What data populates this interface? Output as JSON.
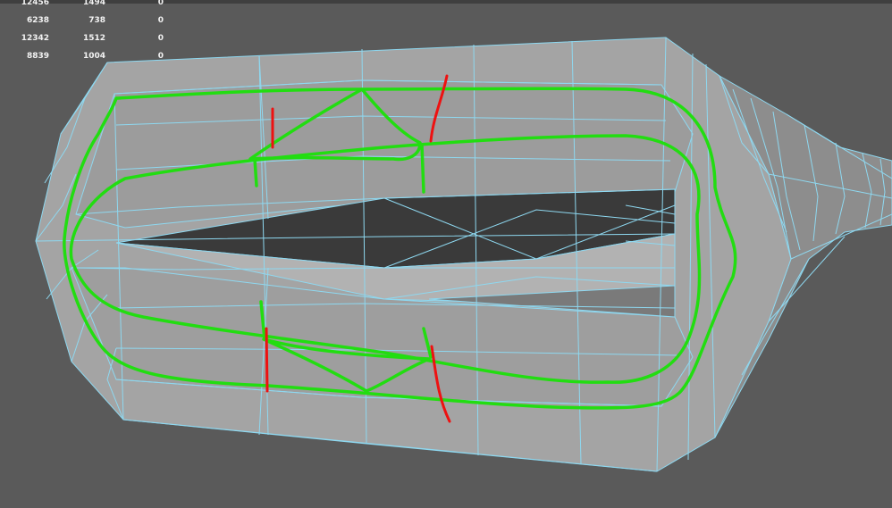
{
  "hud": {
    "rows": [
      [
        "12456",
        "1494",
        "0"
      ],
      [
        "6238",
        "738",
        "0"
      ],
      [
        "12342",
        "1512",
        "0"
      ],
      [
        "8839",
        "1004",
        "0"
      ]
    ]
  },
  "colors": {
    "background": "#5a5a5a",
    "mesh_fill": "#a6a6a6",
    "wire": "#8ed8f0",
    "annotation_green": "#22dd11",
    "annotation_red": "#ee1111"
  }
}
